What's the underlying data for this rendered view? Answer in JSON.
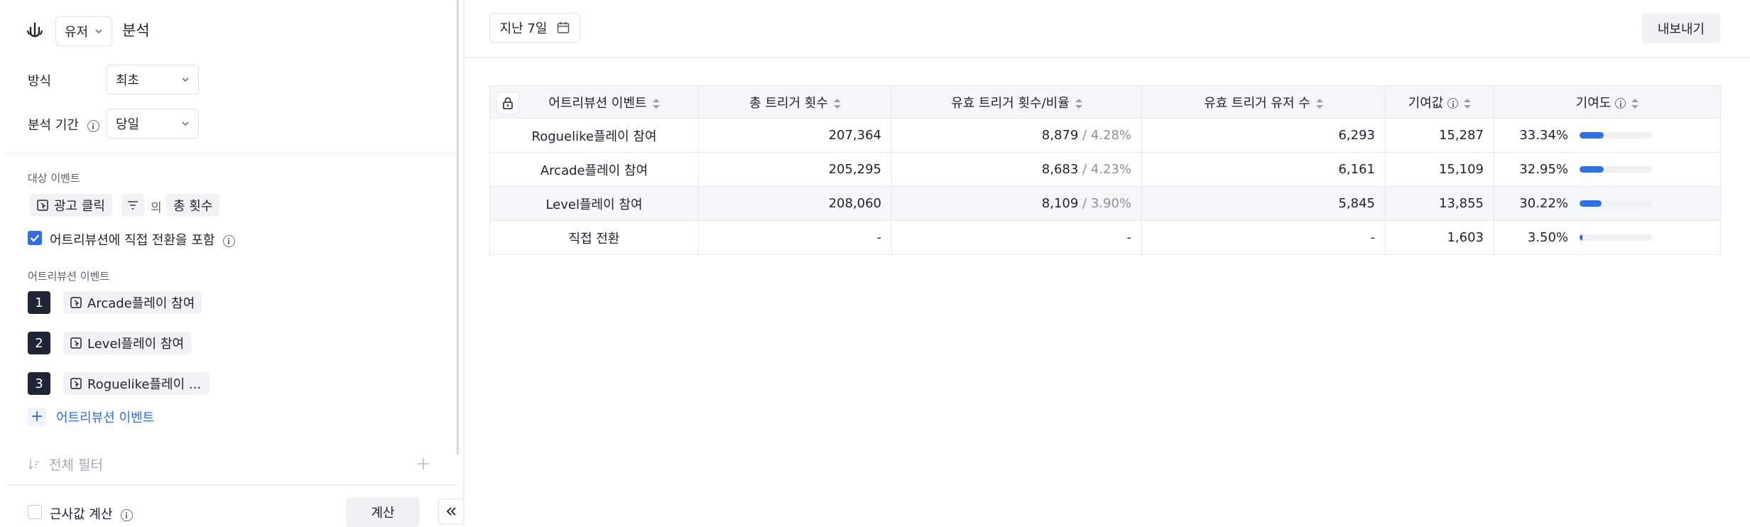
{
  "left": {
    "type_select": "유저",
    "title": "분석",
    "method_label": "방식",
    "method_value": "최초",
    "period_label": "분석 기간",
    "period_value": "당일",
    "target_section": "대상 이벤트",
    "target_event": "광고 클릭",
    "of_text": "의",
    "measure": "총 횟수",
    "include_direct_label": "어트리뷰션에 직접 전환을 포함",
    "include_direct_checked": true,
    "attr_section": "어트리뷰션 이벤트",
    "attr_events": [
      {
        "num": "1",
        "label": "Arcade플레이 참여"
      },
      {
        "num": "2",
        "label": "Level플레이 참여"
      },
      {
        "num": "3",
        "label": "Roguelike플레이 ..."
      }
    ],
    "add_attr_label": "어트리뷰션 이벤트",
    "global_filter_label": "전체 필터",
    "approx_label": "근사값 계산",
    "approx_checked": false,
    "calc_button": "계산"
  },
  "main": {
    "date_range": "지난 7일",
    "export_button": "내보내기",
    "columns": [
      "어트리뷰션 이벤트",
      "총 트리거 횟수",
      "유효 트리거 횟수/비율",
      "유효 트리거 유저 수",
      "기여값",
      "기여도"
    ],
    "rows": [
      {
        "event": "Roguelike플레이 참여",
        "total": "207,364",
        "valid": "8,879",
        "ratio": "4.28%",
        "users": "6,293",
        "value": "15,287",
        "contrib": "33.34%",
        "contrib_pct": 33.34
      },
      {
        "event": "Arcade플레이 참여",
        "total": "205,295",
        "valid": "8,683",
        "ratio": "4.23%",
        "users": "6,161",
        "value": "15,109",
        "contrib": "32.95%",
        "contrib_pct": 32.95
      },
      {
        "event": "Level플레이 참여",
        "total": "208,060",
        "valid": "8,109",
        "ratio": "3.90%",
        "users": "5,845",
        "value": "13,855",
        "contrib": "30.22%",
        "contrib_pct": 30.22
      },
      {
        "event": "직접 전환",
        "total": "-",
        "valid": "-",
        "ratio": "",
        "users": "-",
        "value": "1,603",
        "contrib": "3.50%",
        "contrib_pct": 3.5
      }
    ]
  },
  "colors": {
    "accent": "#2f6ee6",
    "badge": "#1f2533"
  }
}
